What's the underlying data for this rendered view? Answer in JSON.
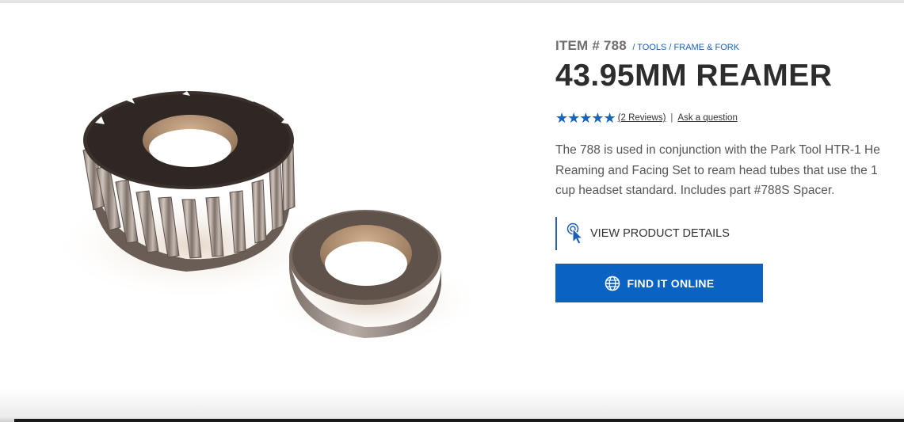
{
  "product": {
    "item_number": "ITEM # 788",
    "breadcrumb": [
      {
        "label": "TOOLS"
      },
      {
        "label": "FRAME & FORK"
      }
    ],
    "breadcrumb_separator": "/",
    "title": "43.95MM REAMER",
    "rating": {
      "stars": 5,
      "star_glyphs": "★★★★★",
      "reviews_label": "(2 Reviews)",
      "separator": "|",
      "ask_label": "Ask a question"
    },
    "description": "The 788 is used in conjunction with the Park Tool HTR-1 He\nReaming and Facing Set to ream head tubes that use the 1\ncup headset standard. Includes part #788S Spacer."
  },
  "actions": {
    "view_details_label": "VIEW PRODUCT DETAILS",
    "view_details_icon": "pointer-click-icon",
    "find_online_label": "FIND IT ONLINE",
    "find_online_icon": "globe-icon"
  },
  "colors": {
    "accent": "#0a63c2",
    "star": "#1565c0",
    "link": "#1a5fb4",
    "title": "#2d2d2d"
  }
}
